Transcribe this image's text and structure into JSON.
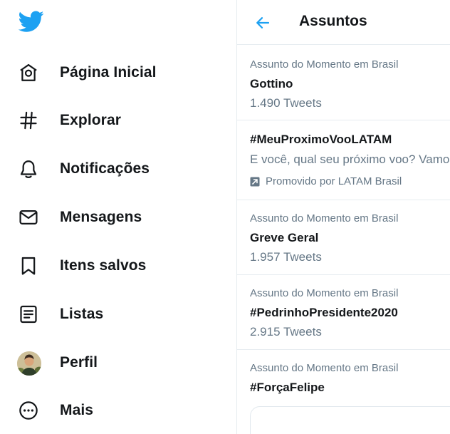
{
  "sidebar": {
    "logo_icon": "twitter-bird-icon",
    "items": [
      {
        "label": "Página Inicial",
        "icon": "home-icon"
      },
      {
        "label": "Explorar",
        "icon": "hashtag-icon"
      },
      {
        "label": "Notificações",
        "icon": "bell-icon"
      },
      {
        "label": "Mensagens",
        "icon": "envelope-icon"
      },
      {
        "label": "Itens salvos",
        "icon": "bookmark-icon"
      },
      {
        "label": "Listas",
        "icon": "list-icon"
      },
      {
        "label": "Perfil",
        "icon": "avatar"
      },
      {
        "label": "Mais",
        "icon": "more-circle-icon"
      }
    ]
  },
  "header": {
    "title": "Assuntos",
    "back_icon": "arrow-left-icon"
  },
  "trends": [
    {
      "context": "Assunto do Momento em Brasil",
      "name": "Gottino",
      "count": "1.490 Tweets"
    },
    {
      "name": "#MeuProximoVooLATAM",
      "description": "E você, qual seu próximo voo? Vamos",
      "promoted": "Promovido por LATAM Brasil"
    },
    {
      "context": "Assunto do Momento em Brasil",
      "name": "Greve Geral",
      "count": "1.957 Tweets"
    },
    {
      "context": "Assunto do Momento em Brasil",
      "name": "#PedrinhoPresidente2020",
      "count": "2.915 Tweets"
    },
    {
      "context": "Assunto do Momento em Brasil",
      "name": "#ForçaFelipe"
    }
  ],
  "colors": {
    "accent": "#1da1f2",
    "text": "#14171a",
    "secondary_text": "#657786",
    "border": "#e6ecf0"
  }
}
